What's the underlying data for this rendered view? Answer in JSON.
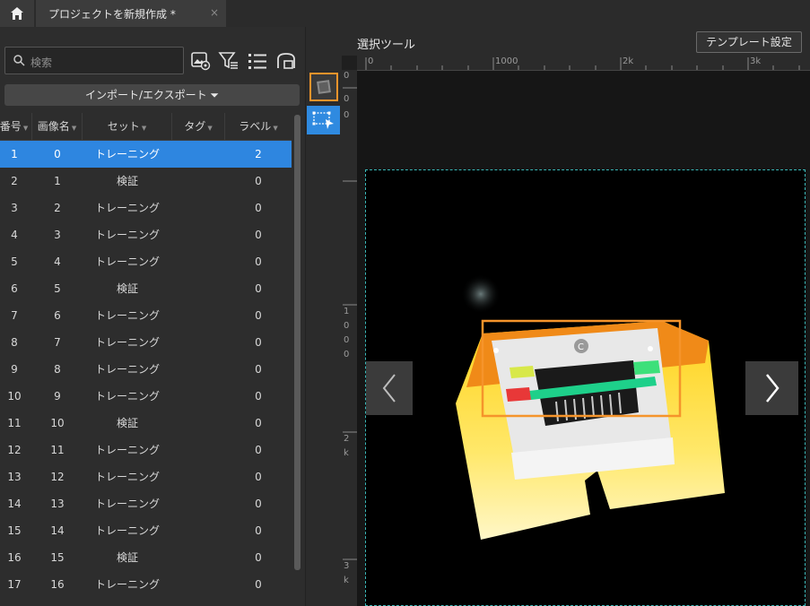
{
  "tabbar": {
    "project_tab_label": "プロジェクトを新規作成 *",
    "close_glyph": "×"
  },
  "left_panel": {
    "search_placeholder": "検索",
    "import_export_label": "インポート/エクスポート ⏷",
    "columns": [
      "番号",
      "画像名",
      "セット",
      "タグ",
      "ラベル"
    ],
    "rows": [
      {
        "no": "1",
        "name": "0",
        "set": "トレーニング",
        "tag": "",
        "label": "2",
        "selected": true
      },
      {
        "no": "2",
        "name": "1",
        "set": "検証",
        "tag": "",
        "label": "0"
      },
      {
        "no": "3",
        "name": "2",
        "set": "トレーニング",
        "tag": "",
        "label": "0"
      },
      {
        "no": "4",
        "name": "3",
        "set": "トレーニング",
        "tag": "",
        "label": "0"
      },
      {
        "no": "5",
        "name": "4",
        "set": "トレーニング",
        "tag": "",
        "label": "0"
      },
      {
        "no": "6",
        "name": "5",
        "set": "検証",
        "tag": "",
        "label": "0"
      },
      {
        "no": "7",
        "name": "6",
        "set": "トレーニング",
        "tag": "",
        "label": "0"
      },
      {
        "no": "8",
        "name": "7",
        "set": "トレーニング",
        "tag": "",
        "label": "0"
      },
      {
        "no": "9",
        "name": "8",
        "set": "トレーニング",
        "tag": "",
        "label": "0"
      },
      {
        "no": "10",
        "name": "9",
        "set": "トレーニング",
        "tag": "",
        "label": "0"
      },
      {
        "no": "11",
        "name": "10",
        "set": "検証",
        "tag": "",
        "label": "0"
      },
      {
        "no": "12",
        "name": "11",
        "set": "トレーニング",
        "tag": "",
        "label": "0"
      },
      {
        "no": "13",
        "name": "12",
        "set": "トレーニング",
        "tag": "",
        "label": "0"
      },
      {
        "no": "14",
        "name": "13",
        "set": "トレーニング",
        "tag": "",
        "label": "0"
      },
      {
        "no": "15",
        "name": "14",
        "set": "トレーニング",
        "tag": "",
        "label": "0"
      },
      {
        "no": "16",
        "name": "15",
        "set": "検証",
        "tag": "",
        "label": "0"
      },
      {
        "no": "17",
        "name": "16",
        "set": "トレーニング",
        "tag": "",
        "label": "0"
      }
    ]
  },
  "right_panel": {
    "title": "選択ツール",
    "template_button": "テンプレート設定",
    "ruler_top": [
      "0",
      "1000",
      "2k",
      "3k"
    ],
    "ruler_left": [
      "0",
      "0",
      "0",
      "1",
      "0",
      "0",
      "0",
      "2",
      "k",
      "3",
      "k"
    ]
  },
  "colors": {
    "accent": "#2e86e0",
    "highlight": "#f5942b",
    "roi": "#3bb8b8"
  }
}
